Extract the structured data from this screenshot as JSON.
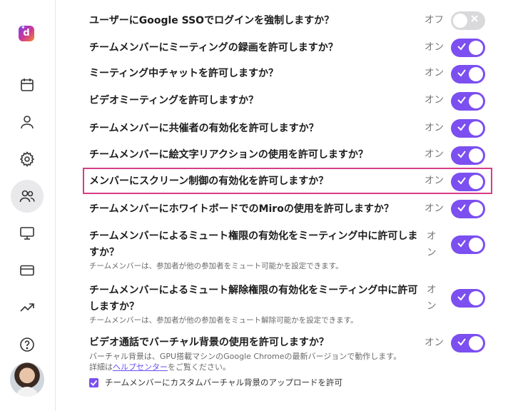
{
  "sidebar": {
    "logo_letter": "d",
    "logo_spark": "✦",
    "nav": [
      {
        "icon": "calendar-icon"
      },
      {
        "icon": "user-icon"
      },
      {
        "icon": "gear-icon"
      },
      {
        "icon": "team-icon",
        "active": true
      },
      {
        "icon": "monitor-icon"
      },
      {
        "icon": "credit-card-icon"
      },
      {
        "icon": "trending-icon"
      },
      {
        "icon": "help-icon"
      }
    ]
  },
  "settings": [
    {
      "question": "ユーザーにGoogle SSOでログインを強制しますか？",
      "state": "オフ",
      "enabled": false
    },
    {
      "question": "チームメンバーにミーティングの録画を許可しますか？",
      "state": "オン",
      "enabled": true
    },
    {
      "question": "ミーティング中チャットを許可しますか？",
      "state": "オン",
      "enabled": true
    },
    {
      "question": "ビデオミーティングを許可しますか？",
      "state": "オン",
      "enabled": true
    },
    {
      "question": "チームメンバーに共催者の有効化を許可しますか？",
      "state": "オン",
      "enabled": true
    },
    {
      "question": "チームメンバーに絵文字リアクションの使用を許可しますか？",
      "state": "オン",
      "enabled": true
    },
    {
      "question": "メンバーにスクリーン制御の有効化を許可しますか？",
      "state": "オン",
      "enabled": true
    },
    {
      "question": "チームメンバーにホワイトボードでのMiroの使用を許可しますか？",
      "state": "オン",
      "enabled": true
    },
    {
      "question": "チームメンバーによるミュート権限の有効化をミーティング中に許可しますか？",
      "description": "チームメンバーは、参加者が他の参加者をミュート可能かを設定できます。",
      "state": "オン",
      "enabled": true
    },
    {
      "question": "チームメンバーによるミュート解除権限の有効化をミーティング中に許可しますか？",
      "description": "チームメンバーは、参加者が他の参加者をミュート解除可能かを設定できます。",
      "state": "オン",
      "enabled": true
    },
    {
      "question": "ビデオ通話でバーチャル背景の使用を許可しますか？",
      "description_before": "バーチャル背景は、GPU搭載マシンのGoogle Chromeの最新バージョンで動作します。詳細は",
      "description_link": "ヘルプセンター",
      "description_after": "をご覧ください。",
      "state": "オン",
      "enabled": true
    }
  ],
  "custom_background": {
    "label": "チームメンバーにカスタムバーチャル背景のアップロードを許可",
    "checked": true
  },
  "colors": {
    "accent": "#7b4ff0",
    "highlight": "#d63c86",
    "toggle_off": "#d9d9dc"
  }
}
